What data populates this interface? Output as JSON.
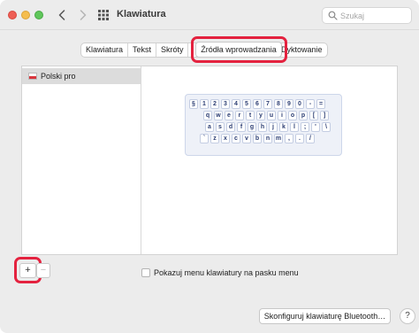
{
  "window": {
    "title": "Klawiatura"
  },
  "search": {
    "placeholder": "Szukaj"
  },
  "tabs": [
    {
      "label": "Klawiatura"
    },
    {
      "label": "Tekst"
    },
    {
      "label": "Skróty"
    },
    {
      "label": "Źródła wprowadzania"
    },
    {
      "label": "Dyktowanie"
    }
  ],
  "input_sources": {
    "items": [
      {
        "label": "Polski pro",
        "flag": "polish-flag-icon"
      }
    ]
  },
  "keyboard_preview": {
    "rows": [
      [
        "§",
        "1",
        "2",
        "3",
        "4",
        "5",
        "6",
        "7",
        "8",
        "9",
        "0",
        "-",
        "="
      ],
      [
        "q",
        "w",
        "e",
        "r",
        "t",
        "y",
        "u",
        "i",
        "o",
        "p",
        "[",
        "]"
      ],
      [
        "a",
        "s",
        "d",
        "f",
        "g",
        "h",
        "j",
        "k",
        "l",
        ";",
        "'",
        "\\"
      ],
      [
        "`",
        "z",
        "x",
        "c",
        "v",
        "b",
        "n",
        "m",
        ",",
        ".",
        "/"
      ]
    ]
  },
  "controls": {
    "add_label": "+",
    "remove_label": "−",
    "show_menu_label": "Pokazuj menu klawiatury na pasku menu",
    "show_menu_checked": false,
    "bluetooth_button": "Skonfiguruj klawiaturę Bluetooth…",
    "help_label": "?"
  },
  "colors": {
    "highlight": "#e4223f",
    "selection": "#dcdcdc"
  }
}
